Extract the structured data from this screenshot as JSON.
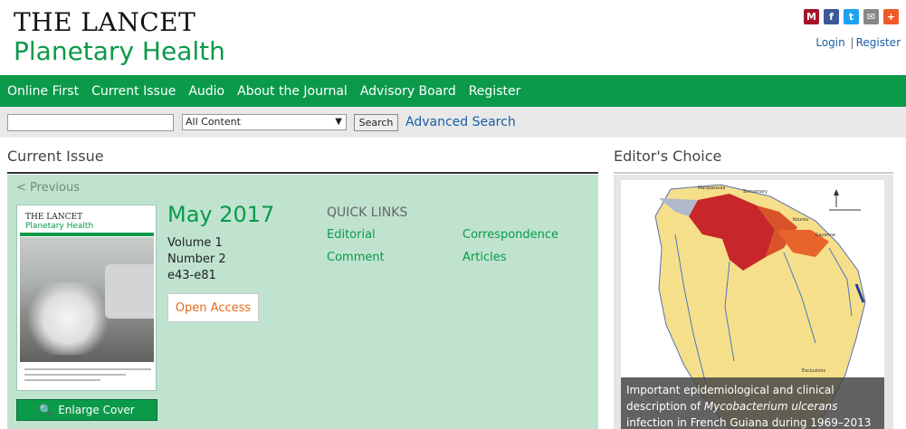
{
  "header": {
    "logo_line1": "THE LANCET",
    "logo_line2": "Planetary Health",
    "login": "Login",
    "separator": "|",
    "register": "Register",
    "share_icons": [
      "mendeley-icon",
      "facebook-icon",
      "twitter-icon",
      "email-icon",
      "share-plus-icon"
    ]
  },
  "nav": {
    "items": [
      "Online First",
      "Current Issue",
      "Audio",
      "About the Journal",
      "Advisory Board",
      "Register"
    ]
  },
  "search": {
    "input_value": "",
    "select_value": "All Content",
    "button_label": "Search",
    "advanced_label": "Advanced Search"
  },
  "current_issue": {
    "heading": "Current Issue",
    "prev_label": "< Previous",
    "cover_title1": "THE LANCET",
    "cover_title2": "Planetary Health",
    "enlarge_label": "Enlarge Cover",
    "date": "May 2017",
    "volume": "Volume 1",
    "number": "Number 2",
    "pages": "e43-e81",
    "open_access": "Open Access",
    "quick_links_title": "QUICK LINKS",
    "quick_links": [
      "Editorial",
      "Correspondence",
      "Comment",
      "Articles"
    ]
  },
  "editors_choice": {
    "heading": "Editor's Choice",
    "caption_line1": "Important epidemiological and clinical",
    "caption_line2_pre": "description of ",
    "caption_line2_em": "Mycobacterium ulcerans",
    "caption_line3": "infection in French Guiana during 1969–2013"
  },
  "colors": {
    "brand_green": "#0a9a4a",
    "panel_green": "#bfe3cf",
    "link_blue": "#1a5ea5",
    "open_access_orange": "#e86a1a"
  }
}
